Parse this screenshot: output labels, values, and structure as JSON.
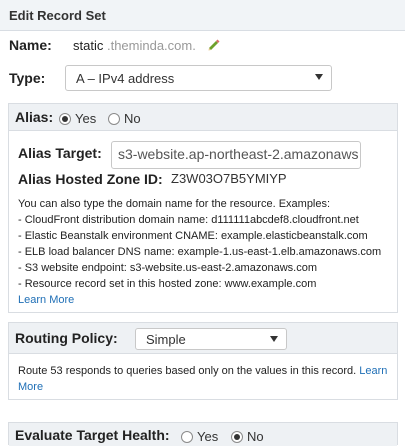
{
  "header": {
    "title": "Edit Record Set"
  },
  "name": {
    "label": "Name:",
    "value": "static",
    "suffix": ".theminda.com."
  },
  "type": {
    "label": "Type:",
    "selected": "A – IPv4 address"
  },
  "alias": {
    "label": "Alias:",
    "options": [
      "Yes",
      "No"
    ],
    "target_label": "Alias Target:",
    "target_value": "s3-website.ap-northeast-2.amazonaws",
    "zone_label": "Alias Hosted Zone ID:",
    "zone_value": "Z3W03O7B5YMIYP",
    "help_intro": "You can also type the domain name for the resource. Examples:",
    "help_items": [
      "- CloudFront distribution domain name: d111111abcdef8.cloudfront.net",
      "- Elastic Beanstalk environment CNAME: example.elasticbeanstalk.com",
      "- ELB load balancer DNS name: example-1.us-east-1.elb.amazonaws.com",
      "- S3 website endpoint: s3-website.us-east-2.amazonaws.com",
      "- Resource record set in this hosted zone: www.example.com"
    ],
    "learn_more": "Learn More"
  },
  "routing": {
    "label": "Routing Policy:",
    "selected": "Simple",
    "help": "Route 53 responds to queries based only on the values in this record.",
    "learn_more_1": "Learn",
    "learn_more_2": "More"
  },
  "health": {
    "label": "Evaluate Target Health:",
    "options": [
      "Yes",
      "No"
    ]
  },
  "icons": {
    "pencil": "pencil-icon",
    "caret": "chevron-down-icon"
  }
}
